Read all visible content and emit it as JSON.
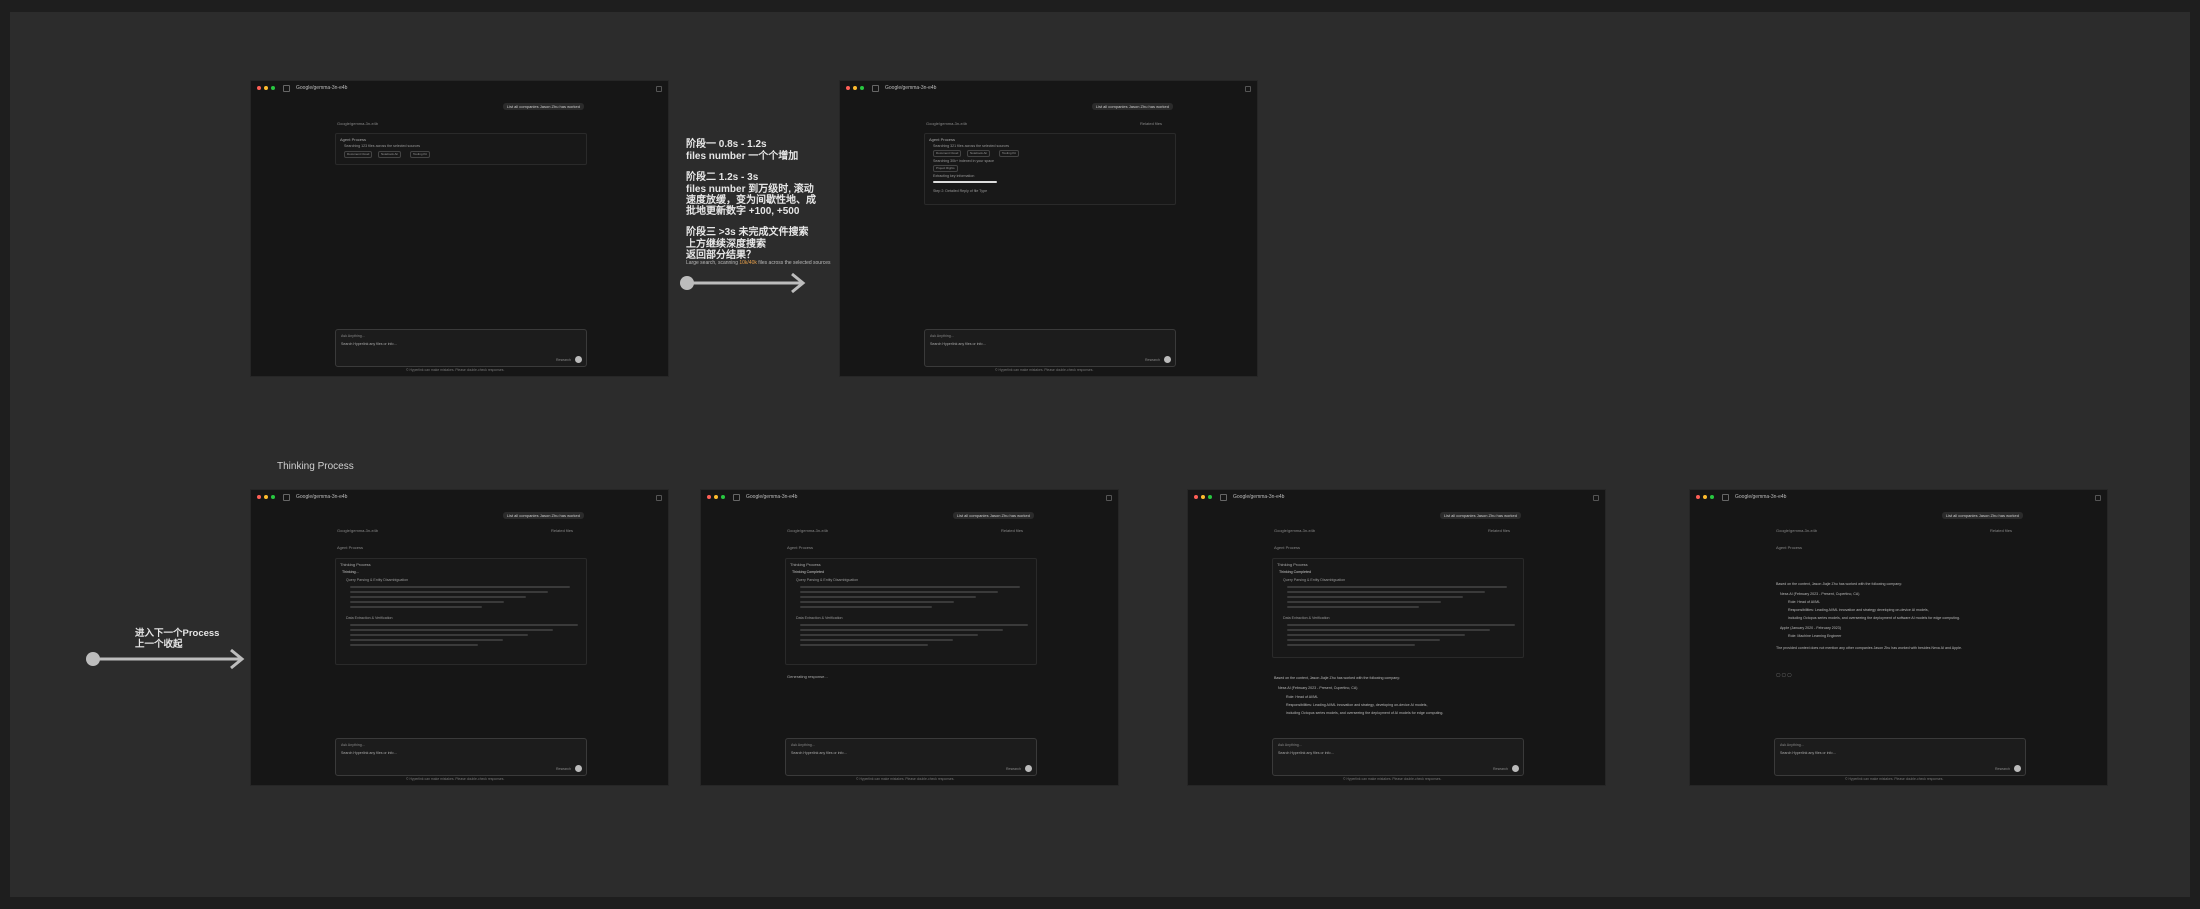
{
  "app": {
    "model": "Google/gemma-3n-e4b",
    "model_chevron_icon": "chevron-down-icon",
    "user_prompt": "List all companies Jason Zhu has worked",
    "context_file": "Google/gemma-3n-e4b",
    "related_files": "Related files",
    "composer_placeholder": "Ask Anything…",
    "composer_hint": "Search Hyperlink any files or info…",
    "mode": "Research",
    "footer": "© Hyperlink can make mistakes. Please double-check responses."
  },
  "colors": {
    "red": "#ff5f57",
    "yellow": "#febc2e",
    "green": "#28c840",
    "accent_orange": "#e8a04a"
  },
  "top_frames": [
    {
      "panel_title": "Agent Process",
      "steps": [
        "Searching 123 files across the selected sources"
      ],
      "chips": [
        "Document Cloud",
        "Notebook Air",
        "Tooling Kit"
      ]
    },
    {
      "panel_title": "Agent Process",
      "steps": [
        "Searching 321 files across the selected sources",
        "Searching 30k+ indexed in your space",
        "Extracting key information",
        "Step 2: Detailed Reply of file Type"
      ],
      "chips": [
        "Document Cloud",
        "Notebook Air",
        "Tooling Kit",
        "Project Rights"
      ]
    }
  ],
  "notes": {
    "stage1": "阶段一 0.8s - 1.2s",
    "stage1_desc": "files number  一个个增加",
    "stage2": "阶段二 1.2s - 3s",
    "stage2_desc": [
      "files number 到万级时, 滚动",
      "速度放缓，变为间歇性地、成",
      "批地更新数字 +100, +500"
    ],
    "stage3": "阶段三 >3s 未完成文件搜索",
    "stage3_desc": [
      "上方继续深度搜索",
      "返回部分结果？"
    ],
    "small_pre": "Large search, scanning ",
    "small_highlight": "10k/40k",
    "small_post": " files across the selected sources",
    "bottom_label": "Thinking Process",
    "collapse_a": "进入下一个Process",
    "collapse_b": "上一个收起"
  },
  "bottom_frames": [
    {
      "panel_title": "Agent Process",
      "sub_title": "Thinking Process",
      "status": "Thinking…",
      "sections": [
        "Query Parsing & Entity Disambiguation",
        "Data Extraction & Verification"
      ],
      "generating": ""
    },
    {
      "panel_title": "Agent Process",
      "sub_title": "Thinking Process",
      "status": "Thinking Completed",
      "sections": [
        "Query Parsing & Entity Disambiguation",
        "Data Extraction & Verification"
      ],
      "generating": "Generating response..."
    },
    {
      "panel_title": "Agent Process",
      "sub_title": "Thinking Process",
      "status": "Thinking Completed",
      "sections": [
        "Query Parsing & Entity Disambiguation",
        "Data Extraction & Verification"
      ],
      "answer_intro": "Based on the context, Jason Jiajie Zhu has worked with the following company:",
      "answer_items": [
        "Nexa AI (February 2023 - Present, Cupertino, CA)",
        "Role: Head of AI/ML",
        "Responsibilities: Leading AI/ML innovation and strategy, developing on-device AI models,",
        "including Octopus series models, and overseeing the deployment of AI models for edge computing."
      ]
    },
    {
      "panel_title": "Agent Process",
      "answer_intro": "Based on the context, Jason Jiajie Zhu has worked with the following company:",
      "answer_items": [
        "Nexa AI (February 2023 - Present, Cupertino, CA)",
        "Role: Head of AI/ML",
        "Responsibilities: Leading AI/ML innovation and strategy developing on-device AI models,",
        "including Octopus series models, and overseeing the deployment of software AI models for edge computing.",
        "Apple (January 2020 - February 2023)",
        "Role: Machine Learning Engineer"
      ],
      "answer_outro": "The provided context does not mention any other companies Jason Zhu has worked with besides Nexa AI and Apple."
    }
  ]
}
